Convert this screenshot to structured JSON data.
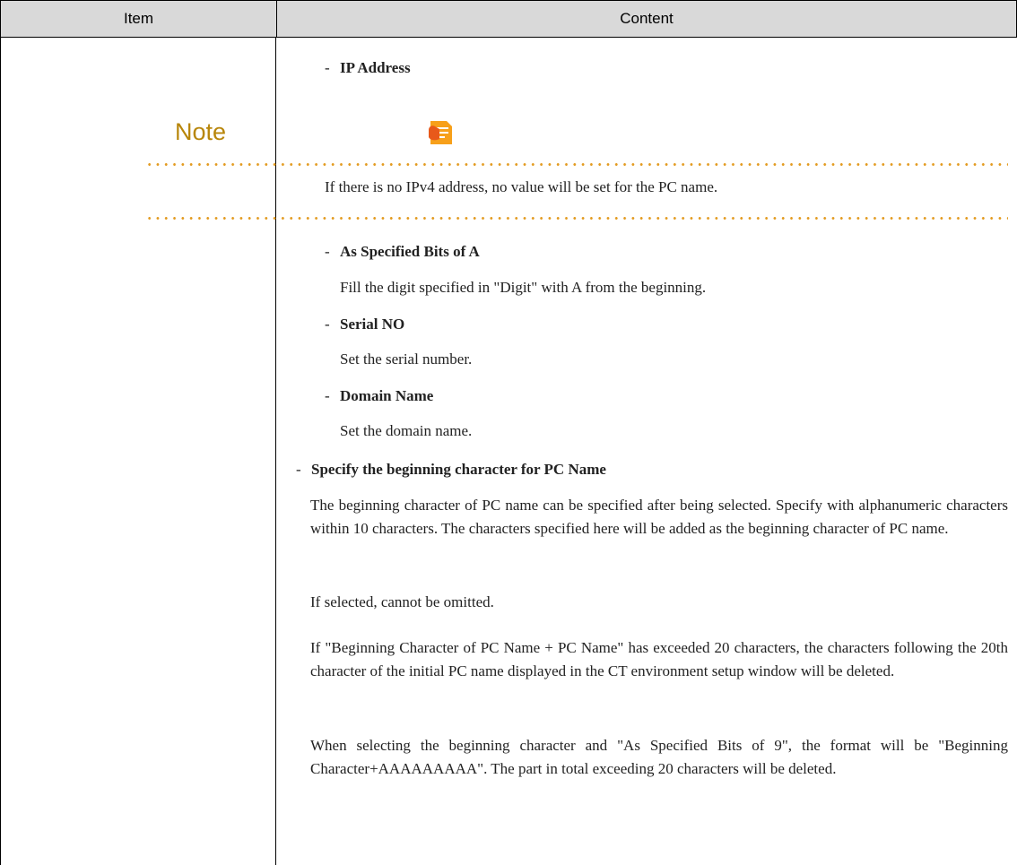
{
  "table": {
    "header": {
      "item": "Item",
      "content": "Content"
    }
  },
  "content": {
    "ip_address": "IP Address",
    "note": {
      "title": "Note",
      "text": "If there is no IPv4 address, no value will be set for the PC name."
    },
    "bits_of_a": {
      "label": "As Specified Bits of A",
      "desc": "Fill the digit specified in \"Digit\" with A from the beginning."
    },
    "serial_no": {
      "label": "Serial NO",
      "desc": "Set the serial number."
    },
    "domain_name": {
      "label": "Domain Name",
      "desc": "Set the domain name."
    },
    "beginning_char": {
      "label": "Specify the beginning character for PC Name",
      "para1": "The beginning character of PC name can be specified after being selected. Specify with alphanumeric characters within 10 characters. The characters specified here will be added as the beginning character of PC name.",
      "para2": "If selected, cannot be omitted.",
      "para3": "If \"Beginning Character of PC Name + PC Name\" has exceeded 20 characters, the characters following the 20th character of the initial PC name displayed in the CT environment setup window will be deleted.",
      "para4": "When selecting the beginning character and \"As Specified Bits of 9\", the format will be \"Beginning Character+AAAAAAAAA\". The part in total exceeding 20 characters will be deleted."
    }
  },
  "colors": {
    "header_bg": "#d9d9d9",
    "note_accent": "#e39b20",
    "note_title": "#b8860b"
  }
}
